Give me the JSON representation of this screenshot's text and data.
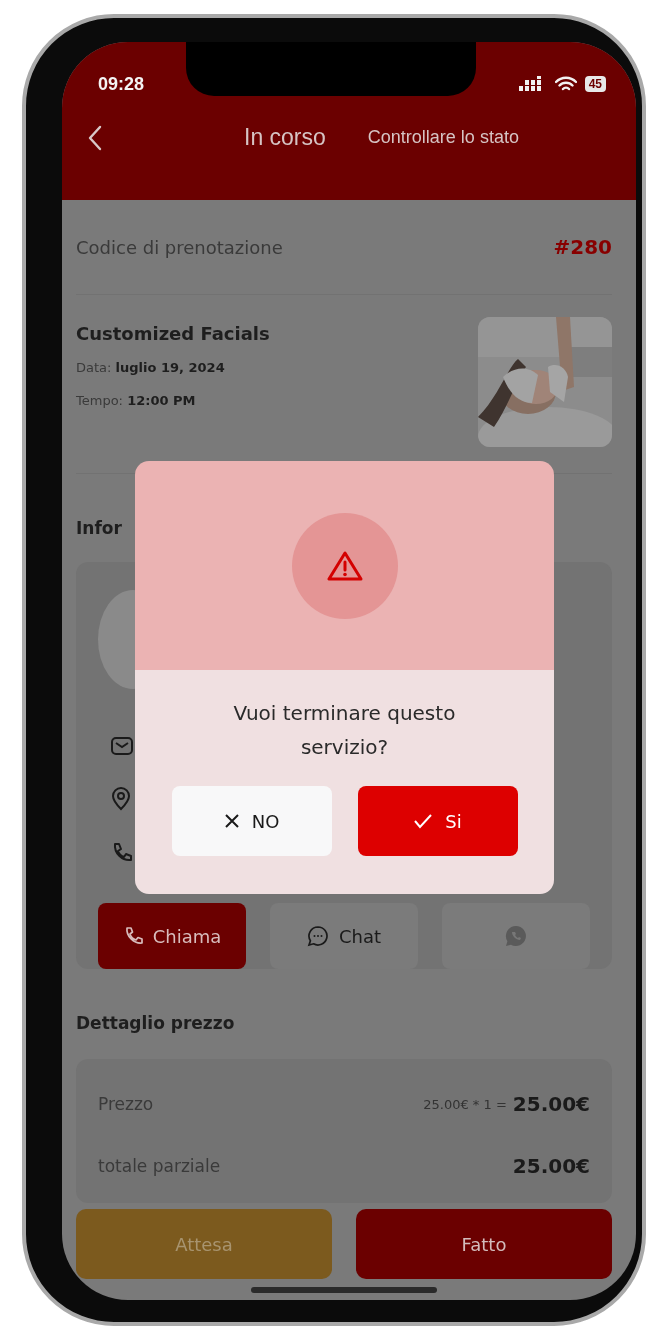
{
  "status_bar": {
    "time": "09:28",
    "battery": "45"
  },
  "header": {
    "title": "In corso",
    "action": "Controllare lo stato"
  },
  "booking": {
    "label": "Codice di prenotazione",
    "code": "#280"
  },
  "service": {
    "name": "Customized Facials",
    "details": [
      {
        "label": "Data:",
        "value": "luglio 19, 2024"
      },
      {
        "label": "Tempo:",
        "value": "12:00 PM"
      }
    ]
  },
  "info": {
    "title": "Infor",
    "contact_rows": [
      {
        "kind": "email"
      },
      {
        "kind": "location"
      },
      {
        "kind": "phone"
      }
    ],
    "contact_buttons": [
      {
        "kind": "call",
        "label": "Chiama",
        "primary": true
      },
      {
        "kind": "chat",
        "label": "Chat",
        "primary": false
      },
      {
        "kind": "whatsapp",
        "primary": false
      }
    ]
  },
  "price": {
    "title": "Dettaglio prezzo",
    "rows": [
      {
        "label": "Prezzo",
        "formula": "25.00€ * 1  =",
        "amount": "25.00€"
      },
      {
        "label": "totale parziale",
        "amount": "25.00€"
      }
    ]
  },
  "actions": [
    {
      "kind": "wait",
      "label": "Attesa"
    },
    {
      "kind": "done",
      "label": "Fatto"
    }
  ],
  "dialog": {
    "message": "Vuoi terminare questo servizio?",
    "buttons": [
      {
        "kind": "cancel",
        "label": "NO"
      },
      {
        "kind": "confirm",
        "label": "Si"
      }
    ]
  }
}
